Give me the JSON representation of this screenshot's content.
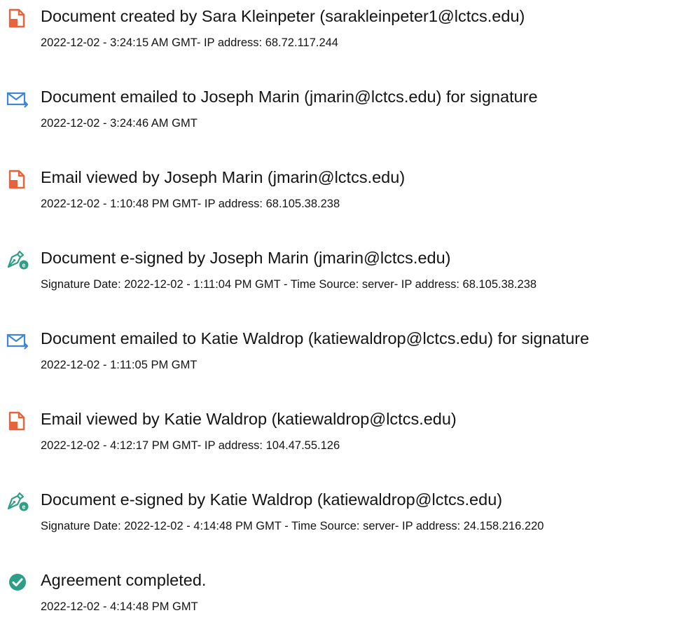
{
  "events": [
    {
      "icon": "document-created-icon",
      "title": "Document created by Sara Kleinpeter (sarakleinpeter1@lctcs.edu)",
      "detail": "2022-12-02 - 3:24:15 AM GMT- IP address: 68.72.117.244"
    },
    {
      "icon": "email-sent-icon",
      "title": "Document emailed to Joseph Marin (jmarin@lctcs.edu) for signature",
      "detail": "2022-12-02 - 3:24:46 AM GMT"
    },
    {
      "icon": "email-viewed-icon",
      "title": "Email viewed by Joseph Marin (jmarin@lctcs.edu)",
      "detail": "2022-12-02 - 1:10:48 PM GMT- IP address: 68.105.38.238"
    },
    {
      "icon": "esign-pen-icon",
      "title": "Document e-signed by Joseph Marin (jmarin@lctcs.edu)",
      "detail": "Signature Date: 2022-12-02 - 1:11:04 PM GMT - Time Source: server- IP address: 68.105.38.238"
    },
    {
      "icon": "email-sent-icon",
      "title": "Document emailed to Katie Waldrop (katiewaldrop@lctcs.edu) for signature",
      "detail": "2022-12-02 - 1:11:05 PM GMT"
    },
    {
      "icon": "email-viewed-icon",
      "title": "Email viewed by Katie Waldrop (katiewaldrop@lctcs.edu)",
      "detail": "2022-12-02 - 4:12:17 PM GMT- IP address: 104.47.55.126"
    },
    {
      "icon": "esign-pen-icon",
      "title": "Document e-signed by Katie Waldrop (katiewaldrop@lctcs.edu)",
      "detail": "Signature Date: 2022-12-02 - 4:14:48 PM GMT - Time Source: server- IP address: 24.158.216.220"
    },
    {
      "icon": "agreement-completed-check-icon",
      "title": "Agreement completed.",
      "detail": "2022-12-02 - 4:14:48 PM GMT"
    }
  ],
  "colors": {
    "document_icon": "#e8623c",
    "email_icon": "#3f86d8",
    "esign_icon": "#2f9e86",
    "check_icon": "#2f9e86",
    "text": "#141414"
  }
}
